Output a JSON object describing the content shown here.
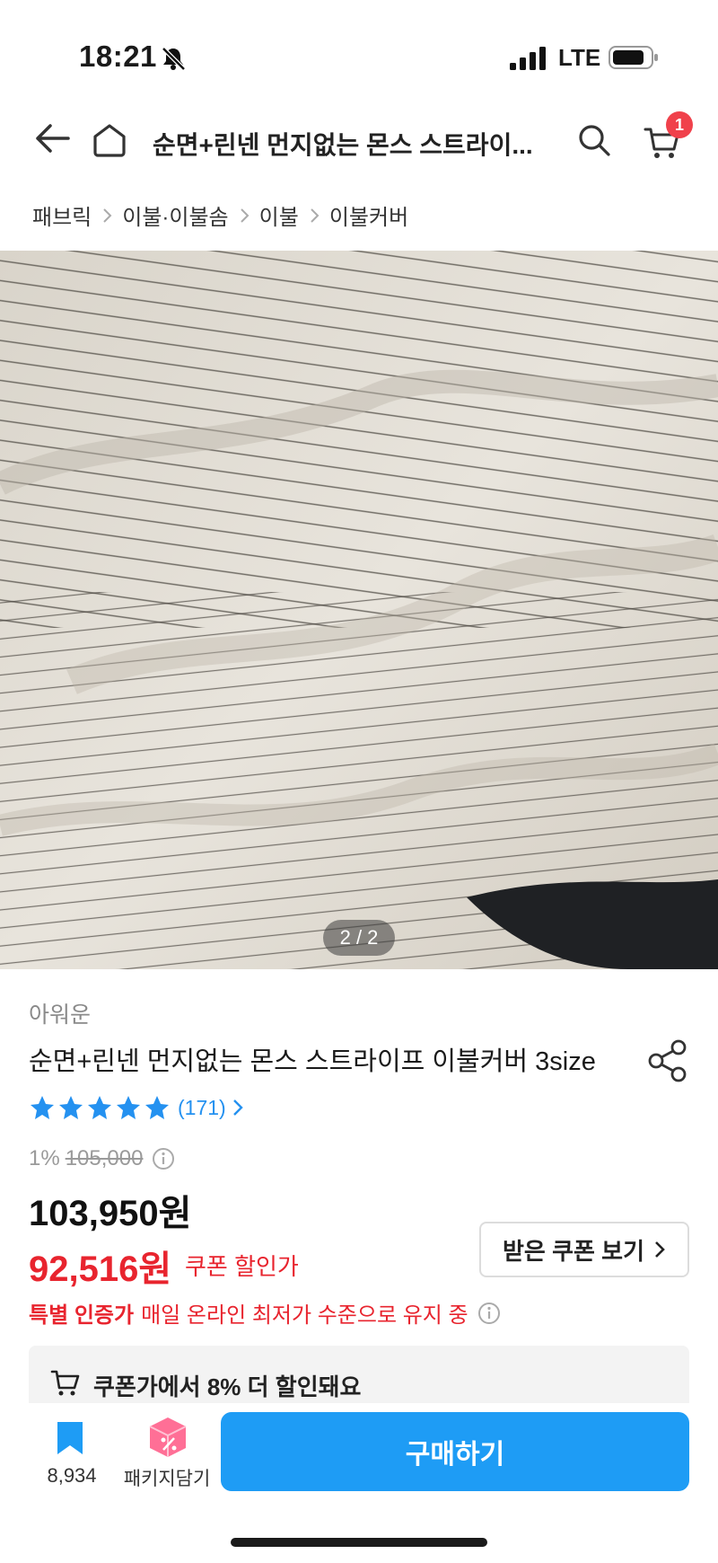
{
  "status_bar": {
    "time": "18:21",
    "network": "LTE"
  },
  "header": {
    "title": "순면+린넨 먼지없는 몬스 스트라이...",
    "cart_badge": "1"
  },
  "breadcrumb": [
    "패브릭",
    "이불·이불솜",
    "이불",
    "이불커버"
  ],
  "image": {
    "indicator": "2 / 2"
  },
  "product": {
    "brand": "아워운",
    "title": "순면+린넨 먼지없는 몬스 스트라이프 이불커버 3size",
    "rating_stars": 5,
    "review_count": "(171)",
    "discount_percent": "1%",
    "original_price": "105,000",
    "sale_price": "103,950원",
    "coupon_price": "92,516원",
    "coupon_label": "쿠폰 할인가",
    "coupon_button": "받은 쿠폰 보기",
    "certified_strong": "특별 인증가",
    "certified_text": "매일 온라인 최저가 수준으로 유지 중",
    "promo_text": "쿠폰가에서 8% 더 할인돼요"
  },
  "bottom_bar": {
    "bookmark_count": "8,934",
    "package_label": "패키지담기",
    "buy_label": "구매하기"
  },
  "colors": {
    "accent": "#1e9cf5",
    "sale_red": "#e8242e",
    "star_blue": "#2491f0"
  }
}
